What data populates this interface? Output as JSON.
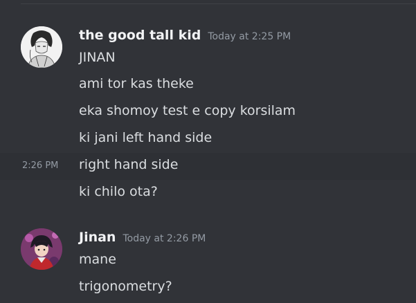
{
  "messages": [
    {
      "username": "the good tall kid",
      "timestamp": "Today at 2:25 PM",
      "avatar_icon": "manga-sketch-avatar",
      "lines": [
        {
          "text": "JINAN"
        },
        {
          "text": "ami tor kas theke"
        },
        {
          "text": "eka shomoy test e copy korsilam"
        },
        {
          "text": "ki jani left hand side"
        },
        {
          "text": "right hand side",
          "side_time": "2:26 PM"
        },
        {
          "text": "ki chilo ota?"
        }
      ]
    },
    {
      "username": "Jinan",
      "timestamp": "Today at 2:26 PM",
      "avatar_icon": "anime-character-avatar",
      "lines": [
        {
          "text": "mane"
        },
        {
          "text": "trigonometry?"
        }
      ]
    }
  ],
  "colors": {
    "background": "#313338",
    "hover": "#2e3035",
    "username": "#f2f3f5",
    "muted": "#949ba4",
    "text": "#dbdee1"
  }
}
